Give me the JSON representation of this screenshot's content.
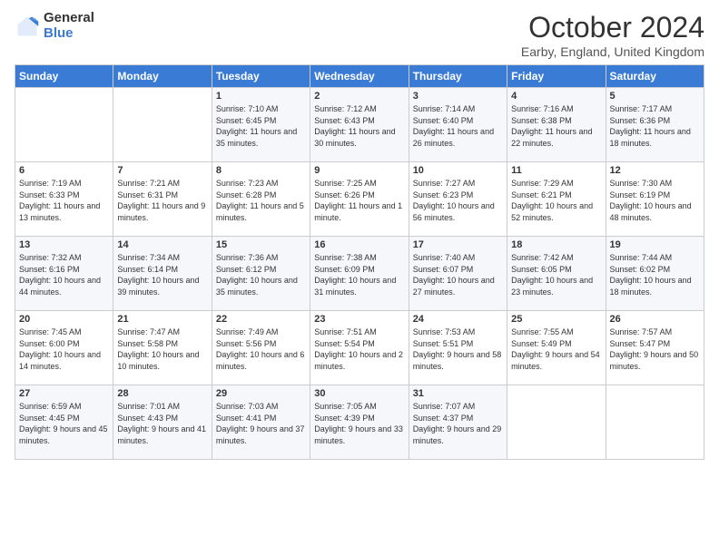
{
  "logo": {
    "general": "General",
    "blue": "Blue"
  },
  "header": {
    "month": "October 2024",
    "location": "Earby, England, United Kingdom"
  },
  "days_of_week": [
    "Sunday",
    "Monday",
    "Tuesday",
    "Wednesday",
    "Thursday",
    "Friday",
    "Saturday"
  ],
  "weeks": [
    [
      {
        "num": "",
        "sunrise": "",
        "sunset": "",
        "daylight": ""
      },
      {
        "num": "",
        "sunrise": "",
        "sunset": "",
        "daylight": ""
      },
      {
        "num": "1",
        "sunrise": "Sunrise: 7:10 AM",
        "sunset": "Sunset: 6:45 PM",
        "daylight": "Daylight: 11 hours and 35 minutes."
      },
      {
        "num": "2",
        "sunrise": "Sunrise: 7:12 AM",
        "sunset": "Sunset: 6:43 PM",
        "daylight": "Daylight: 11 hours and 30 minutes."
      },
      {
        "num": "3",
        "sunrise": "Sunrise: 7:14 AM",
        "sunset": "Sunset: 6:40 PM",
        "daylight": "Daylight: 11 hours and 26 minutes."
      },
      {
        "num": "4",
        "sunrise": "Sunrise: 7:16 AM",
        "sunset": "Sunset: 6:38 PM",
        "daylight": "Daylight: 11 hours and 22 minutes."
      },
      {
        "num": "5",
        "sunrise": "Sunrise: 7:17 AM",
        "sunset": "Sunset: 6:36 PM",
        "daylight": "Daylight: 11 hours and 18 minutes."
      }
    ],
    [
      {
        "num": "6",
        "sunrise": "Sunrise: 7:19 AM",
        "sunset": "Sunset: 6:33 PM",
        "daylight": "Daylight: 11 hours and 13 minutes."
      },
      {
        "num": "7",
        "sunrise": "Sunrise: 7:21 AM",
        "sunset": "Sunset: 6:31 PM",
        "daylight": "Daylight: 11 hours and 9 minutes."
      },
      {
        "num": "8",
        "sunrise": "Sunrise: 7:23 AM",
        "sunset": "Sunset: 6:28 PM",
        "daylight": "Daylight: 11 hours and 5 minutes."
      },
      {
        "num": "9",
        "sunrise": "Sunrise: 7:25 AM",
        "sunset": "Sunset: 6:26 PM",
        "daylight": "Daylight: 11 hours and 1 minute."
      },
      {
        "num": "10",
        "sunrise": "Sunrise: 7:27 AM",
        "sunset": "Sunset: 6:23 PM",
        "daylight": "Daylight: 10 hours and 56 minutes."
      },
      {
        "num": "11",
        "sunrise": "Sunrise: 7:29 AM",
        "sunset": "Sunset: 6:21 PM",
        "daylight": "Daylight: 10 hours and 52 minutes."
      },
      {
        "num": "12",
        "sunrise": "Sunrise: 7:30 AM",
        "sunset": "Sunset: 6:19 PM",
        "daylight": "Daylight: 10 hours and 48 minutes."
      }
    ],
    [
      {
        "num": "13",
        "sunrise": "Sunrise: 7:32 AM",
        "sunset": "Sunset: 6:16 PM",
        "daylight": "Daylight: 10 hours and 44 minutes."
      },
      {
        "num": "14",
        "sunrise": "Sunrise: 7:34 AM",
        "sunset": "Sunset: 6:14 PM",
        "daylight": "Daylight: 10 hours and 39 minutes."
      },
      {
        "num": "15",
        "sunrise": "Sunrise: 7:36 AM",
        "sunset": "Sunset: 6:12 PM",
        "daylight": "Daylight: 10 hours and 35 minutes."
      },
      {
        "num": "16",
        "sunrise": "Sunrise: 7:38 AM",
        "sunset": "Sunset: 6:09 PM",
        "daylight": "Daylight: 10 hours and 31 minutes."
      },
      {
        "num": "17",
        "sunrise": "Sunrise: 7:40 AM",
        "sunset": "Sunset: 6:07 PM",
        "daylight": "Daylight: 10 hours and 27 minutes."
      },
      {
        "num": "18",
        "sunrise": "Sunrise: 7:42 AM",
        "sunset": "Sunset: 6:05 PM",
        "daylight": "Daylight: 10 hours and 23 minutes."
      },
      {
        "num": "19",
        "sunrise": "Sunrise: 7:44 AM",
        "sunset": "Sunset: 6:02 PM",
        "daylight": "Daylight: 10 hours and 18 minutes."
      }
    ],
    [
      {
        "num": "20",
        "sunrise": "Sunrise: 7:45 AM",
        "sunset": "Sunset: 6:00 PM",
        "daylight": "Daylight: 10 hours and 14 minutes."
      },
      {
        "num": "21",
        "sunrise": "Sunrise: 7:47 AM",
        "sunset": "Sunset: 5:58 PM",
        "daylight": "Daylight: 10 hours and 10 minutes."
      },
      {
        "num": "22",
        "sunrise": "Sunrise: 7:49 AM",
        "sunset": "Sunset: 5:56 PM",
        "daylight": "Daylight: 10 hours and 6 minutes."
      },
      {
        "num": "23",
        "sunrise": "Sunrise: 7:51 AM",
        "sunset": "Sunset: 5:54 PM",
        "daylight": "Daylight: 10 hours and 2 minutes."
      },
      {
        "num": "24",
        "sunrise": "Sunrise: 7:53 AM",
        "sunset": "Sunset: 5:51 PM",
        "daylight": "Daylight: 9 hours and 58 minutes."
      },
      {
        "num": "25",
        "sunrise": "Sunrise: 7:55 AM",
        "sunset": "Sunset: 5:49 PM",
        "daylight": "Daylight: 9 hours and 54 minutes."
      },
      {
        "num": "26",
        "sunrise": "Sunrise: 7:57 AM",
        "sunset": "Sunset: 5:47 PM",
        "daylight": "Daylight: 9 hours and 50 minutes."
      }
    ],
    [
      {
        "num": "27",
        "sunrise": "Sunrise: 6:59 AM",
        "sunset": "Sunset: 4:45 PM",
        "daylight": "Daylight: 9 hours and 45 minutes."
      },
      {
        "num": "28",
        "sunrise": "Sunrise: 7:01 AM",
        "sunset": "Sunset: 4:43 PM",
        "daylight": "Daylight: 9 hours and 41 minutes."
      },
      {
        "num": "29",
        "sunrise": "Sunrise: 7:03 AM",
        "sunset": "Sunset: 4:41 PM",
        "daylight": "Daylight: 9 hours and 37 minutes."
      },
      {
        "num": "30",
        "sunrise": "Sunrise: 7:05 AM",
        "sunset": "Sunset: 4:39 PM",
        "daylight": "Daylight: 9 hours and 33 minutes."
      },
      {
        "num": "31",
        "sunrise": "Sunrise: 7:07 AM",
        "sunset": "Sunset: 4:37 PM",
        "daylight": "Daylight: 9 hours and 29 minutes."
      },
      {
        "num": "",
        "sunrise": "",
        "sunset": "",
        "daylight": ""
      },
      {
        "num": "",
        "sunrise": "",
        "sunset": "",
        "daylight": ""
      }
    ]
  ]
}
